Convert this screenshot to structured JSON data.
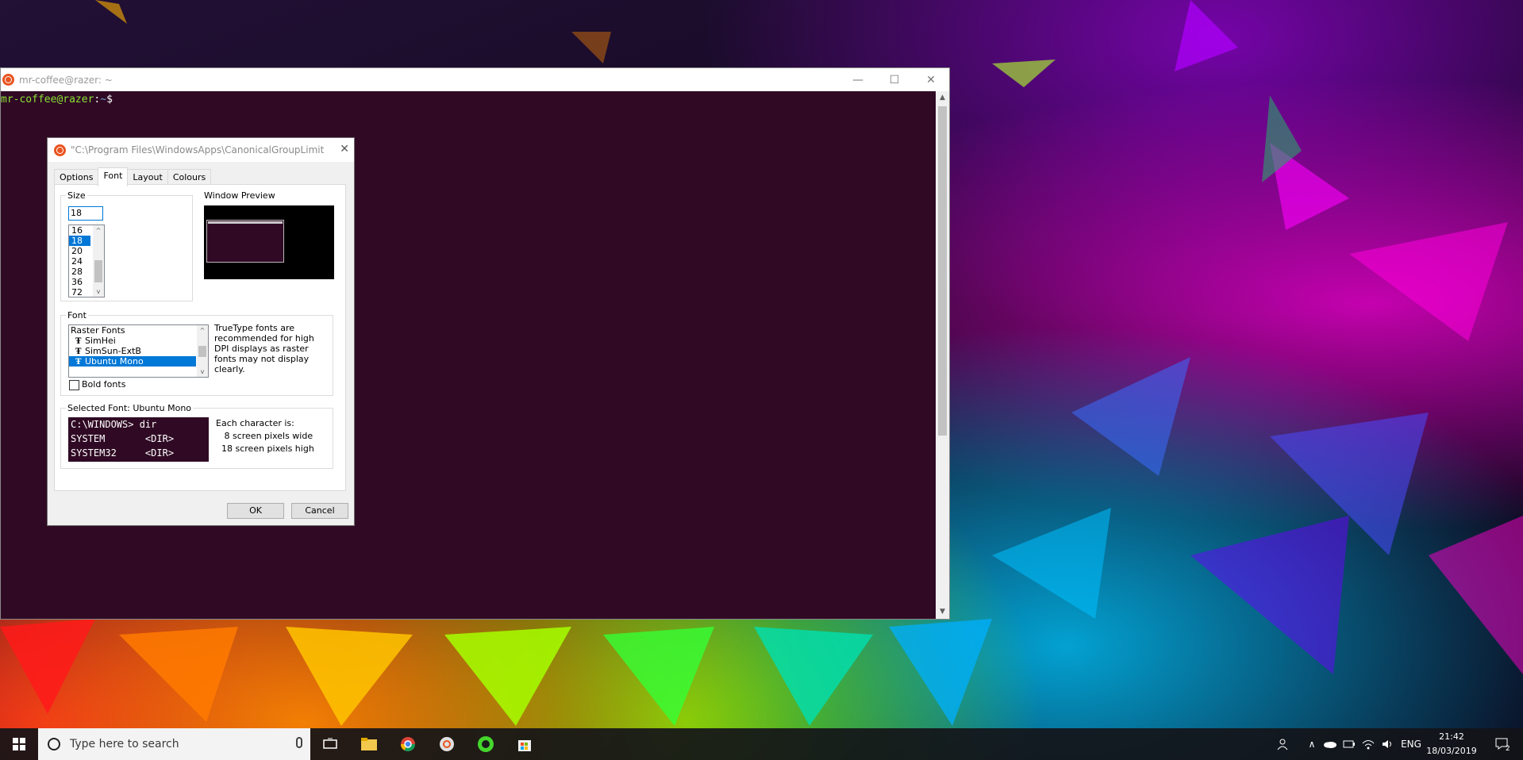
{
  "terminal": {
    "title": "mr-coffee@razer: ~",
    "prompt_user": "mr-coffee@razer",
    "prompt_sep": ":",
    "prompt_path": "~",
    "prompt_symbol": "$",
    "minimize": "—",
    "maximize": "☐",
    "close": "✕"
  },
  "dialog": {
    "title": "\"C:\\Program Files\\WindowsApps\\CanonicalGroupLimited.U...",
    "close": "✕",
    "tabs": [
      "Options",
      "Font",
      "Layout",
      "Colours"
    ],
    "active_tab": "Font",
    "size": {
      "label": "Size",
      "value": "18",
      "options": [
        "16",
        "18",
        "20",
        "24",
        "28",
        "36",
        "72"
      ],
      "selected": "18"
    },
    "preview_label": "Window Preview",
    "font": {
      "label": "Font",
      "items": [
        {
          "name": "Raster Fonts",
          "icon": ""
        },
        {
          "name": "SimHei",
          "icon": "Ŧ"
        },
        {
          "name": "SimSun-ExtB",
          "icon": "Ŧ"
        },
        {
          "name": "Ubuntu Mono",
          "icon": "Ŧ"
        }
      ],
      "selected": "Ubuntu Mono",
      "note": "TrueType fonts are recommended for high DPI displays as raster fonts may not display clearly.",
      "bold_label": "Bold fonts",
      "bold_checked": false
    },
    "selected_font": {
      "label": "Selected Font: Ubuntu Mono",
      "sample_lines": [
        "C:\\WINDOWS> dir",
        "SYSTEM       <DIR>",
        "SYSTEM32     <DIR>"
      ],
      "char_info_title": "Each character is:",
      "char_width": "   8 screen pixels wide",
      "char_height": "  18 screen pixels high"
    },
    "ok_label": "OK",
    "cancel_label": "Cancel"
  },
  "taskbar": {
    "search_placeholder": "Type here to search",
    "language": "ENG",
    "time": "21:42",
    "date": "18/03/2019",
    "notification_count": "2"
  },
  "colors": {
    "terminal_bg": "#300a24",
    "selection": "#0078d7",
    "ubuntu_orange": "#e95420"
  }
}
